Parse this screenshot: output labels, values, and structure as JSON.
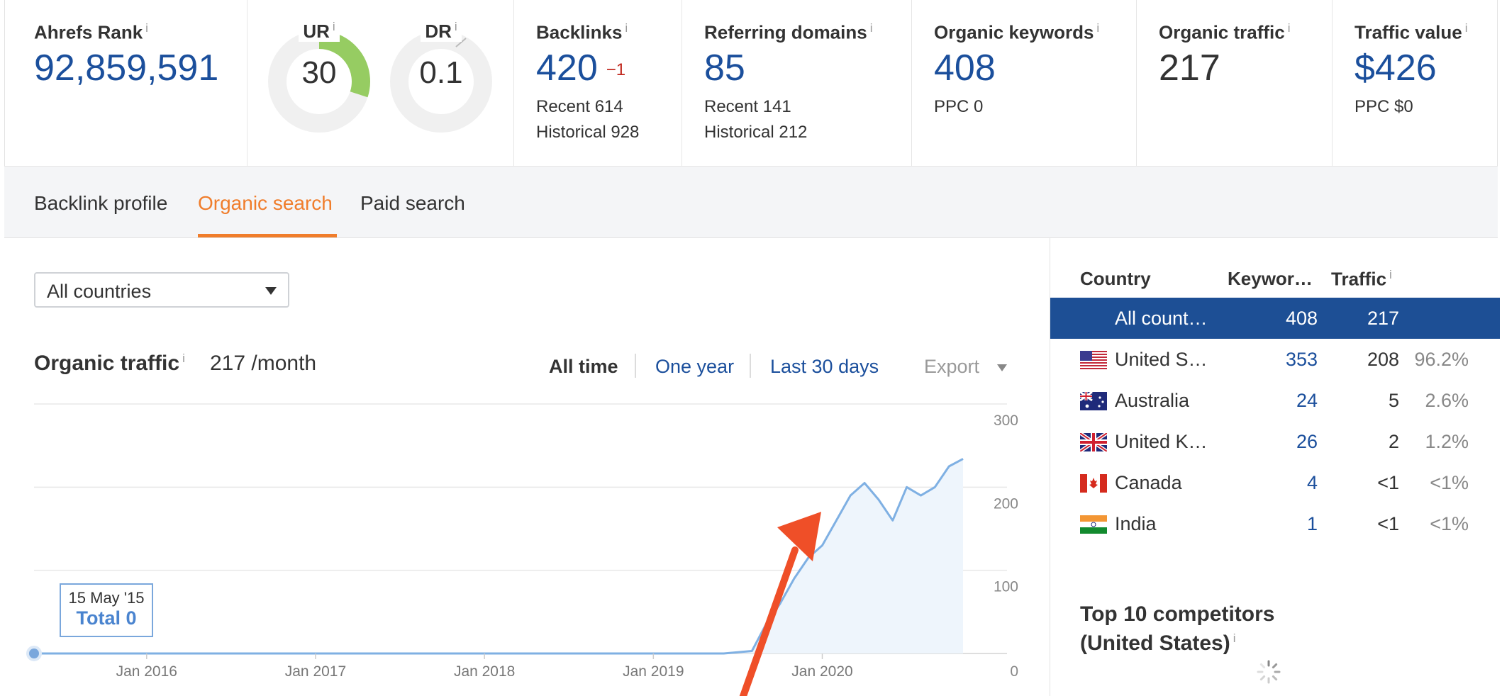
{
  "metrics": {
    "ahrefs_rank": {
      "label": "Ahrefs Rank",
      "value": "92,859,591"
    },
    "ur": {
      "label": "UR",
      "value": "30",
      "fraction": 0.3
    },
    "dr": {
      "label": "DR",
      "value": "0.1",
      "fraction": 0.001
    },
    "backlinks": {
      "label": "Backlinks",
      "value": "420",
      "delta": "−1",
      "recent": "Recent 614",
      "historical": "Historical 928"
    },
    "referring_domains": {
      "label": "Referring domains",
      "value": "85",
      "recent": "Recent 141",
      "historical": "Historical 212"
    },
    "organic_keywords": {
      "label": "Organic keywords",
      "value": "408",
      "ppc": "PPC 0"
    },
    "organic_traffic": {
      "label": "Organic traffic",
      "value": "217"
    },
    "traffic_value": {
      "label": "Traffic value",
      "value": "$426",
      "ppc": "PPC $0"
    },
    "info_glyph": "i"
  },
  "tabs": [
    {
      "label": "Backlink profile",
      "active": false
    },
    {
      "label": "Organic search",
      "active": true
    },
    {
      "label": "Paid search",
      "active": false
    }
  ],
  "filter": {
    "selected": "All countries"
  },
  "chart_header": {
    "title": "Organic traffic",
    "subtitle": "217 /month",
    "ranges": [
      "All time",
      "One year",
      "Last 30 days"
    ],
    "active_range": "All time",
    "export_label": "Export"
  },
  "tooltip": {
    "date": "15 May '15",
    "total": "Total 0"
  },
  "chart_data": {
    "type": "area",
    "x_tick_labels": [
      "Jan 2016",
      "Jan 2017",
      "Jan 2018",
      "Jan 2019",
      "Jan 2020"
    ],
    "y_tick_labels": [
      "300",
      "200",
      "100",
      "0"
    ],
    "ylim": [
      0,
      300
    ],
    "xlim": [
      "2015-05",
      "2020-11"
    ],
    "grid": true,
    "series": [
      {
        "x": [
          "2015-05",
          "2016-01",
          "2017-01",
          "2018-01",
          "2019-01",
          "2019-06",
          "2019-08",
          "2019-09",
          "2019-10",
          "2019-11",
          "2019-12",
          "2020-01",
          "2020-02",
          "2020-03",
          "2020-04",
          "2020-05",
          "2020-06",
          "2020-07",
          "2020-08",
          "2020-09",
          "2020-10",
          "2020-11"
        ],
        "values": [
          0,
          0,
          0,
          0,
          0,
          0,
          3,
          35,
          60,
          90,
          115,
          130,
          160,
          190,
          205,
          185,
          160,
          200,
          190,
          200,
          225,
          234
        ]
      }
    ],
    "colors": {
      "line": "#7fb0e3",
      "fill": "#eef5fc",
      "grid": "#e8e8e8"
    }
  },
  "countries": {
    "headers": {
      "country": "Country",
      "keywords": "Keywor…",
      "traffic": "Traffic"
    },
    "rows": [
      {
        "name": "All count…",
        "keywords": "408",
        "traffic": "217",
        "pct": "",
        "flag": "",
        "selected": true
      },
      {
        "name": "United S…",
        "keywords": "353",
        "traffic": "208",
        "pct": "96.2%",
        "flag": "us-flag-icon",
        "selected": false
      },
      {
        "name": "Australia",
        "keywords": "24",
        "traffic": "5",
        "pct": "2.6%",
        "flag": "au-flag-icon",
        "selected": false
      },
      {
        "name": "United K…",
        "keywords": "26",
        "traffic": "2",
        "pct": "1.2%",
        "flag": "uk-flag-icon",
        "selected": false
      },
      {
        "name": "Canada",
        "keywords": "4",
        "traffic": "<1",
        "pct": "<1%",
        "flag": "ca-flag-icon",
        "selected": false
      },
      {
        "name": "India",
        "keywords": "1",
        "traffic": "<1",
        "pct": "<1%",
        "flag": "in-flag-icon",
        "selected": false
      }
    ]
  },
  "competitors": {
    "line1": "Top 10 competitors",
    "line2": "(United States)"
  },
  "colors": {
    "link_blue": "#1b4f9c",
    "accent_orange": "#f07d2b",
    "ur_green": "#96cc62",
    "arrow_red": "#ef4f28",
    "selected_row": "#1d4f95"
  }
}
